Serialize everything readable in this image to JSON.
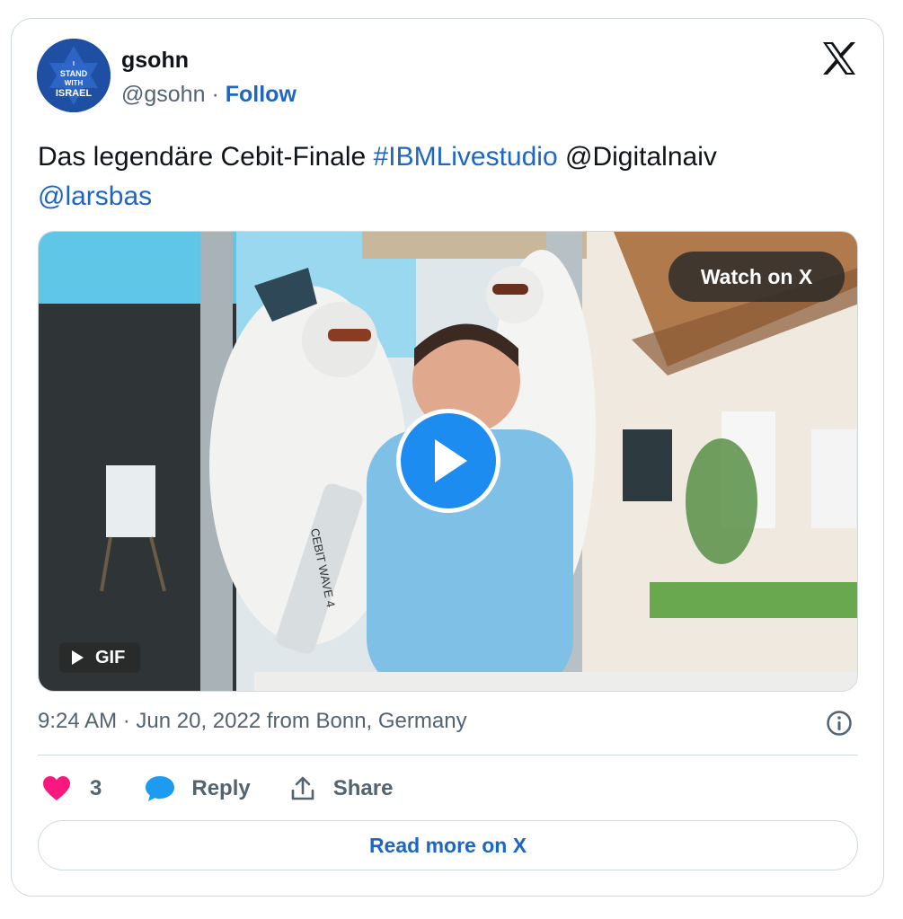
{
  "author": {
    "name": "gsohn",
    "handle": "@gsohn",
    "separator": "·",
    "follow_label": "Follow",
    "avatar_text": [
      "I",
      "STAND",
      "WITH",
      "ISRAEL"
    ]
  },
  "tweet": {
    "text_plain": "Das legendäre Cebit-Finale",
    "hashtag": "#IBMLivestudio",
    "mention1": "@Digitalnaiv",
    "mention2": "@larsbas"
  },
  "media": {
    "watch_label": "Watch on X",
    "gif_label": "GIF",
    "bottle_text": "CEBIT WAVE 4"
  },
  "meta": {
    "timestamp": "9:24 AM · Jun 20, 2022 from Bonn, Germany"
  },
  "actions": {
    "like_count": "3",
    "reply_label": "Reply",
    "share_label": "Share"
  },
  "read_more_label": "Read more on X",
  "colors": {
    "accent": "#1d66c4",
    "like": "#f91880",
    "reply": "#1d9bf0",
    "border": "#cfd9de",
    "muted": "#536471"
  },
  "icons": [
    "x-logo-icon",
    "play-icon",
    "heart-icon",
    "reply-bubble-icon",
    "share-icon",
    "info-icon"
  ]
}
